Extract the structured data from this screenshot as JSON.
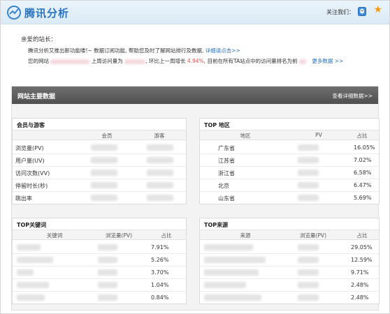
{
  "header": {
    "brand": "腾讯分析",
    "follow_label": "关注我们："
  },
  "greeting": {
    "salutation": "亲爱的站长：",
    "line1_text": "腾讯分析又推出新功能喽!~ 数据订阅功能, 帮助您及时了解网站排行及数据,",
    "line1_link": "详细请点击>>",
    "line2_prefix": "您的网站",
    "line2_mid": "上周访问量为",
    "line2_growth_prefix": "环比上一周增长",
    "line2_growth": "4.94%",
    "line2_rank": "目前在所有TA站点中的访问量排名为前",
    "line2_more": "更多数据 >>"
  },
  "panel": {
    "title": "网站主要数据",
    "detail_link": "查看详细数据>>"
  },
  "members": {
    "title": "会员与游客",
    "columns": [
      "会员",
      "游客"
    ],
    "rows": [
      "浏览量(PV)",
      "用户量(UV)",
      "访问次数(VV)",
      "停留时长(秒)",
      "跳出率"
    ]
  },
  "regions": {
    "title": "TOP 地区",
    "columns": [
      "地区",
      "PV",
      "占比"
    ],
    "rows": [
      {
        "region": "广东省",
        "share": "16.05%"
      },
      {
        "region": "江苏省",
        "share": "7.02%"
      },
      {
        "region": "浙江省",
        "share": "6.58%"
      },
      {
        "region": "北京",
        "share": "6.47%"
      },
      {
        "region": "山东省",
        "share": "5.69%"
      }
    ]
  },
  "keywords": {
    "title": "TOP关键词",
    "columns": [
      "关键词",
      "浏览量(PV)",
      "占比"
    ],
    "shares": [
      "7.91%",
      "5.26%",
      "3.70%",
      "1.04%",
      "0.84%"
    ]
  },
  "sources": {
    "title": "TOP来源",
    "columns": [
      "来源",
      "浏览量(PV)",
      "占比"
    ],
    "shares": [
      "29.05%",
      "12.59%",
      "9.71%",
      "2.48%",
      "2.48%"
    ]
  },
  "colors": {
    "brand": "#2a73bf",
    "link": "#2a6ebb",
    "growth": "#d9534f",
    "bar": "#5a5a5a"
  }
}
